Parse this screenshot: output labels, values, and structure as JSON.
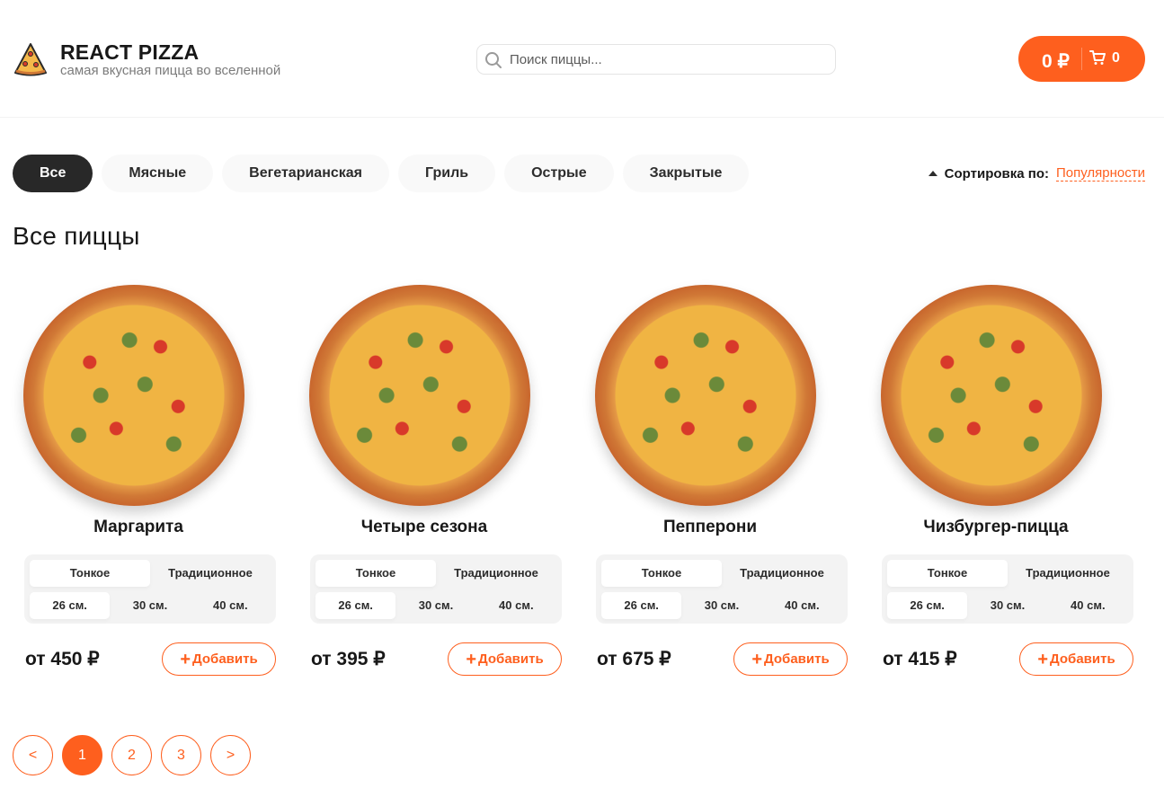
{
  "header": {
    "brand_title": "REACT PIZZA",
    "brand_subtitle": "самая вкусная пицца во вселенной",
    "search_placeholder": "Поиск пиццы...",
    "cart_price": "0 ₽",
    "cart_count": "0"
  },
  "categories": [
    "Все",
    "Мясные",
    "Вегетарианская",
    "Гриль",
    "Острые",
    "Закрытые"
  ],
  "sort": {
    "label": "Сортировка по:",
    "value": "Популярности"
  },
  "section_title": "Все пиццы",
  "pizzas": [
    {
      "name": "Маргарита",
      "price": "от 450 ₽"
    },
    {
      "name": "Четыре сезона",
      "price": "от 395 ₽"
    },
    {
      "name": "Пепперони",
      "price": "от 675 ₽"
    },
    {
      "name": "Чизбургер-пицца",
      "price": "от 415 ₽"
    }
  ],
  "dough_options": [
    "Тонкое",
    "Традиционное"
  ],
  "size_options": [
    "26 см.",
    "30 см.",
    "40 см."
  ],
  "add_label": "Добавить",
  "pagination": {
    "prev": "<",
    "pages": [
      "1",
      "2",
      "3"
    ],
    "next": ">"
  },
  "colors": {
    "accent": "#fe5f1e",
    "dark": "#282828"
  },
  "icons": {
    "logo": "pizza-slice-icon",
    "search": "search-icon",
    "cart": "cart-icon"
  }
}
